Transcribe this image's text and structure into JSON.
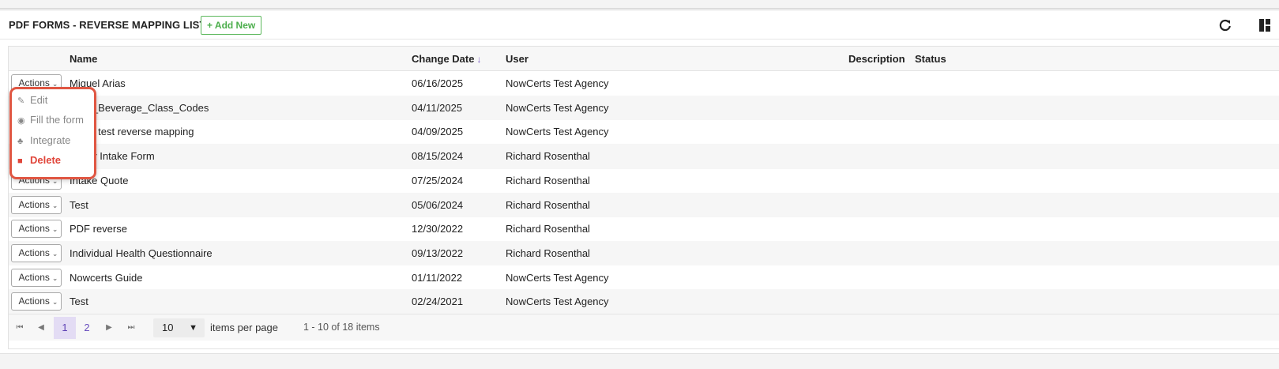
{
  "header": {
    "title": "PDF FORMS - REVERSE MAPPING LIST",
    "add_new_label": "+ Add New",
    "refresh_icon": "refresh-icon",
    "layout_icon": "column-layout-icon"
  },
  "table": {
    "columns": {
      "name": "Name",
      "change_date": "Change Date",
      "sort_indicator": "↓",
      "user": "User",
      "description": "Description",
      "status": "Status"
    },
    "actions_label": "Actions",
    "rows": [
      {
        "name": "Miguel Arias",
        "date": "06/16/2025",
        "user": "NowCerts Test Agency"
      },
      {
        "name": "_and_Beverage_Class_Codes",
        "date": "04/11/2025",
        "user": "NowCerts Test Agency"
      },
      {
        "name": "d 101 test reverse mapping",
        "date": "04/09/2025",
        "user": "NowCerts Test Agency"
      },
      {
        "name": "gency Intake Form",
        "date": "08/15/2024",
        "user": "Richard Rosenthal"
      },
      {
        "name": "Intake Quote",
        "date": "07/25/2024",
        "user": "Richard Rosenthal"
      },
      {
        "name": "Test",
        "date": "05/06/2024",
        "user": "Richard Rosenthal"
      },
      {
        "name": "PDF reverse",
        "date": "12/30/2022",
        "user": "Richard Rosenthal"
      },
      {
        "name": "Individual Health Questionnaire",
        "date": "09/13/2022",
        "user": "Richard Rosenthal"
      },
      {
        "name": "Nowcerts Guide",
        "date": "01/11/2022",
        "user": "NowCerts Test Agency"
      },
      {
        "name": "Test",
        "date": "02/24/2021",
        "user": "NowCerts Test Agency"
      }
    ]
  },
  "dropdown": {
    "items": [
      {
        "label": "Edit",
        "icon": "user-edit-icon"
      },
      {
        "label": "Fill the form",
        "icon": "eye-icon"
      },
      {
        "label": "Integrate",
        "icon": "sitemap-icon"
      },
      {
        "label": "Delete",
        "icon": "trash-icon"
      }
    ],
    "highlight_color": "#e05642"
  },
  "pager": {
    "pages": [
      "1",
      "2"
    ],
    "current_page": "1",
    "per_page_value": "10",
    "per_page_label": "items per page",
    "range_text": "1 - 10 of 18 items"
  },
  "colors": {
    "accent": "#6a4fbf",
    "add_new": "#5cb85c",
    "delete": "#e0453a"
  }
}
